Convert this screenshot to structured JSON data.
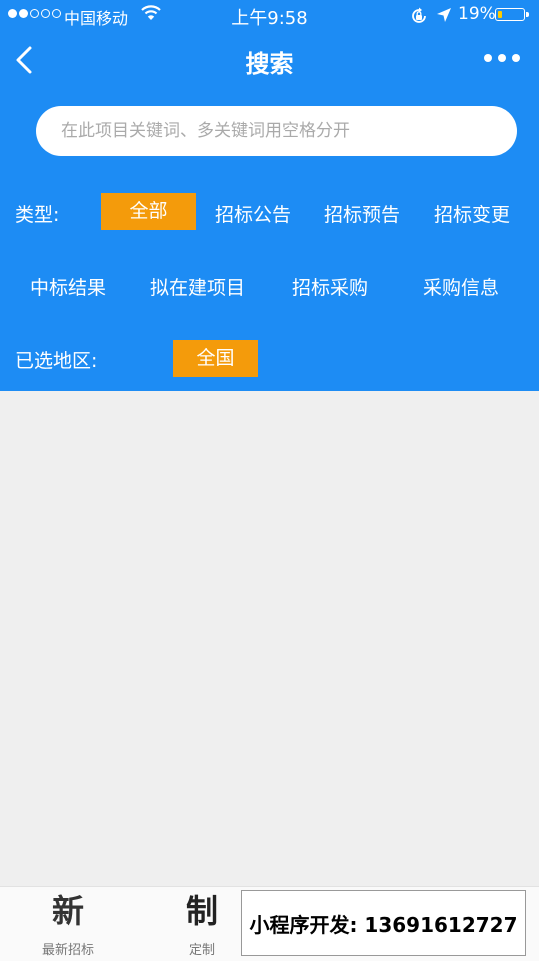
{
  "status_bar": {
    "carrier": "中国移动",
    "time": "上午9:58",
    "battery": "19%",
    "battery_level": 0.19,
    "icons": [
      "signal-dots",
      "wifi-icon",
      "orientation-lock-icon",
      "location-arrow-icon",
      "battery-icon"
    ]
  },
  "nav": {
    "title": "搜索",
    "back_icon": "chevron-left-icon",
    "more_icon": "more-dots-icon"
  },
  "search": {
    "placeholder": "在此项目关键词、多关键词用空格分开",
    "value": ""
  },
  "filters": {
    "type_label": "类型:",
    "types": [
      "全部",
      "招标公告",
      "招标预告",
      "招标变更",
      "中标结果",
      "拟在建项目",
      "招标采购",
      "采购信息"
    ],
    "selected_type": "全部",
    "region_label": "已选地区:",
    "region_value": "全国"
  },
  "tabbar": {
    "items": [
      {
        "icon_glyph": "新",
        "label": "最新招标"
      },
      {
        "icon_glyph": "制",
        "label": "定制"
      }
    ]
  },
  "banner": {
    "text": "小程序开发: 13691612727"
  },
  "colors": {
    "primary": "#1d8cf4",
    "accent": "#f49b0b",
    "background": "#efefef"
  }
}
